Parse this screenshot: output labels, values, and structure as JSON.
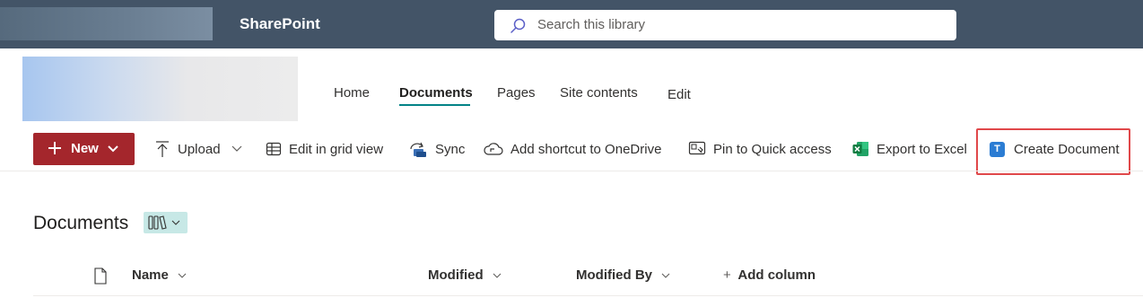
{
  "suitebar": {
    "app_title": "SharePoint",
    "search_placeholder": "Search this library"
  },
  "nav": {
    "items": [
      {
        "label": "Home"
      },
      {
        "label": "Documents",
        "active": true
      },
      {
        "label": "Pages"
      },
      {
        "label": "Site contents"
      },
      {
        "label": "Edit"
      }
    ]
  },
  "commandbar": {
    "new_label": "New",
    "upload_label": "Upload",
    "grid_label": "Edit in grid view",
    "sync_label": "Sync",
    "shortcut_label": "Add shortcut to OneDrive",
    "pin_label": "Pin to Quick access",
    "excel_label": "Export to Excel",
    "create_doc_label": "Create Document",
    "create_doc_icon_letter": "T"
  },
  "library": {
    "title": "Documents",
    "columns": {
      "name": "Name",
      "modified": "Modified",
      "modified_by": "Modified By",
      "add_column": "Add column"
    }
  },
  "colors": {
    "suitebar_bg": "#435467",
    "new_button_bg": "#a4262c",
    "nav_active_underline": "#038387",
    "highlight_border": "#e0484a",
    "excel_green": "#107c41",
    "create_doc_blue": "#2b7cd3"
  }
}
